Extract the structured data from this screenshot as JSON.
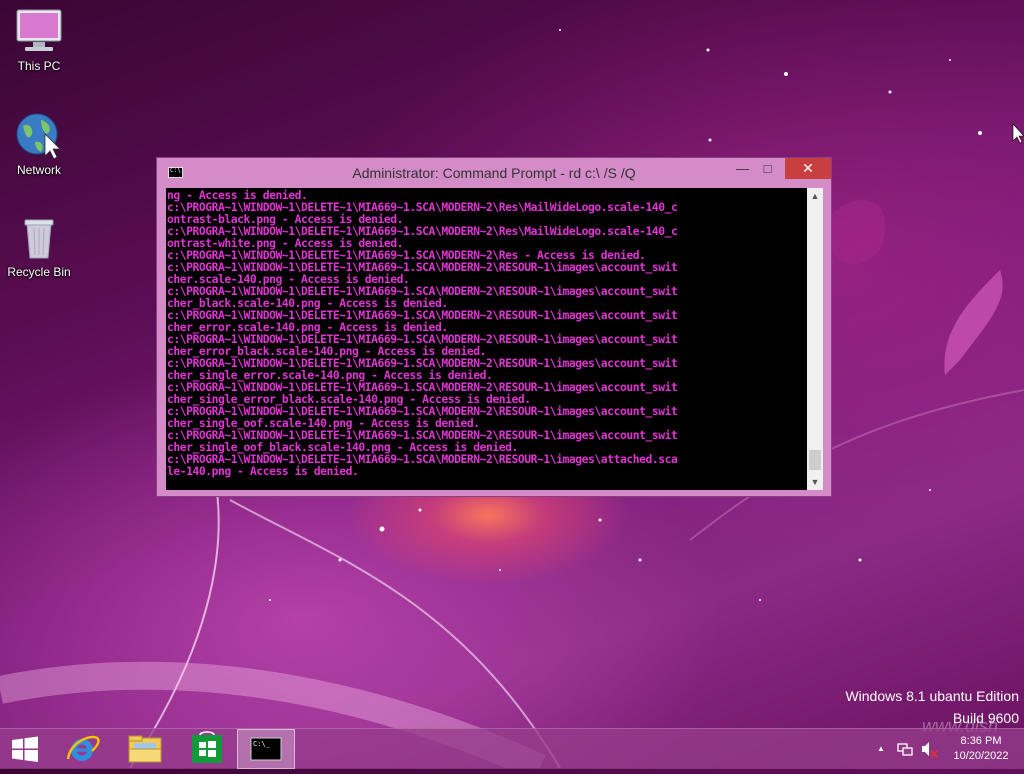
{
  "desktop": {
    "icons": [
      {
        "label": "This PC"
      },
      {
        "label": "Network"
      },
      {
        "label": "Recycle Bin"
      }
    ]
  },
  "window": {
    "title": "Administrator: Command Prompt - rd  c:\\ /S /Q",
    "controls": {
      "minimize": "—",
      "maximize": "□",
      "close": "✕"
    },
    "console_lines": [
      "ng - Access is denied.",
      "c:\\PROGRA~1\\WINDOW~1\\DELETE~1\\MIA669~1.SCA\\MODERN~2\\Res\\MailWideLogo.scale-140_c",
      "ontrast-black.png - Access is denied.",
      "c:\\PROGRA~1\\WINDOW~1\\DELETE~1\\MIA669~1.SCA\\MODERN~2\\Res\\MailWideLogo.scale-140_c",
      "ontrast-white.png - Access is denied.",
      "c:\\PROGRA~1\\WINDOW~1\\DELETE~1\\MIA669~1.SCA\\MODERN~2\\Res - Access is denied.",
      "c:\\PROGRA~1\\WINDOW~1\\DELETE~1\\MIA669~1.SCA\\MODERN~2\\RESOUR~1\\images\\account_swit",
      "cher.scale-140.png - Access is denied.",
      "c:\\PROGRA~1\\WINDOW~1\\DELETE~1\\MIA669~1.SCA\\MODERN~2\\RESOUR~1\\images\\account_swit",
      "cher_black.scale-140.png - Access is denied.",
      "c:\\PROGRA~1\\WINDOW~1\\DELETE~1\\MIA669~1.SCA\\MODERN~2\\RESOUR~1\\images\\account_swit",
      "cher_error.scale-140.png - Access is denied.",
      "c:\\PROGRA~1\\WINDOW~1\\DELETE~1\\MIA669~1.SCA\\MODERN~2\\RESOUR~1\\images\\account_swit",
      "cher_error_black.scale-140.png - Access is denied.",
      "c:\\PROGRA~1\\WINDOW~1\\DELETE~1\\MIA669~1.SCA\\MODERN~2\\RESOUR~1\\images\\account_swit",
      "cher_single_error.scale-140.png - Access is denied.",
      "c:\\PROGRA~1\\WINDOW~1\\DELETE~1\\MIA669~1.SCA\\MODERN~2\\RESOUR~1\\images\\account_swit",
      "cher_single_error_black.scale-140.png - Access is denied.",
      "c:\\PROGRA~1\\WINDOW~1\\DELETE~1\\MIA669~1.SCA\\MODERN~2\\RESOUR~1\\images\\account_swit",
      "cher_single_oof.scale-140.png - Access is denied.",
      "c:\\PROGRA~1\\WINDOW~1\\DELETE~1\\MIA669~1.SCA\\MODERN~2\\RESOUR~1\\images\\account_swit",
      "cher_single_oof_black.scale-140.png - Access is denied.",
      "c:\\PROGRA~1\\WINDOW~1\\DELETE~1\\MIA669~1.SCA\\MODERN~2\\RESOUR~1\\images\\attached.sca",
      "le-140.png - Access is denied."
    ],
    "console_color": "#e134d3"
  },
  "edition": {
    "line1": "Windows 8.1 ubantu Edition",
    "line2": "Build 9600"
  },
  "watermark": "www.dlsh",
  "taskbar": {
    "pinned": [
      {
        "icon": "windows-start-icon"
      },
      {
        "icon": "internet-explorer-icon"
      },
      {
        "icon": "file-explorer-icon"
      },
      {
        "icon": "windows-store-icon"
      },
      {
        "icon": "command-prompt-icon"
      }
    ],
    "clock": {
      "time": "8:36 PM",
      "date": "10/20/2022"
    }
  },
  "colors": {
    "accent": "#d48cc9",
    "close": "#c7403f"
  }
}
